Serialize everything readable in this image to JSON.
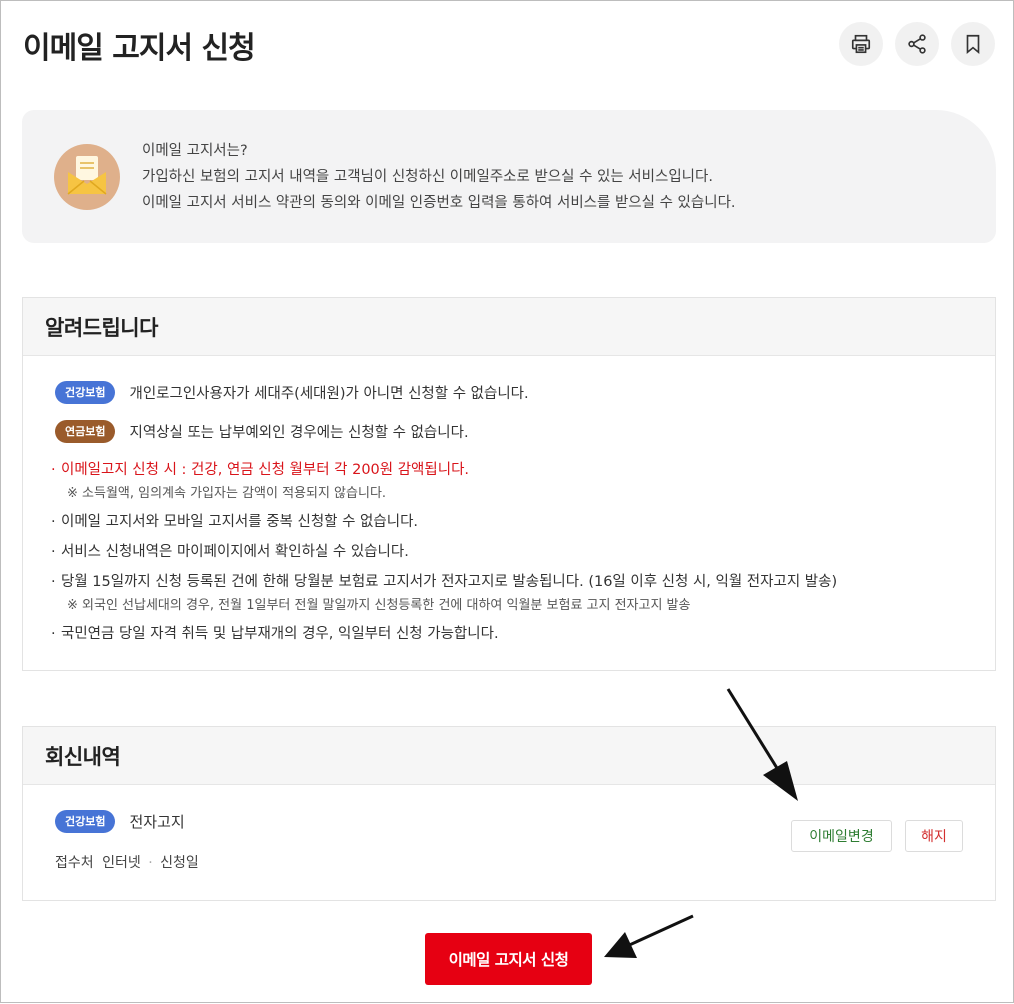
{
  "header": {
    "title": "이메일 고지서 신청",
    "icons": [
      "print-icon",
      "share-icon",
      "bookmark-icon"
    ]
  },
  "intro": {
    "icon": "envelope-icon",
    "lines": [
      "이메일 고지서는?",
      "가입하신 보험의 고지서 내역을 고객님이 신청하신 이메일주소로 받으실 수 있는 서비스입니다.",
      "이메일 고지서 서비스 약관의 동의와 이메일 인증번호 입력을 통하여 서비스를 받으실 수 있습니다."
    ]
  },
  "notice": {
    "title": "알려드립니다",
    "badge_rows": [
      {
        "badge": "건강보험",
        "text": "개인로그인사용자가 세대주(세대원)가 아니면 신청할 수 없습니다."
      },
      {
        "badge": "연금보험",
        "text": "지역상실 또는 납부예외인 경우에는 신청할 수 없습니다."
      }
    ],
    "bullets": [
      {
        "text": "이메일고지 신청 시 : 건강, 연금 신청 월부터 각 200원 감액됩니다.",
        "sub": "※ 소득월액, 임의계속 가입자는 감액이 적용되지 않습니다."
      },
      {
        "text": "이메일 고지서와 모바일 고지서를 중복 신청할 수 없습니다."
      },
      {
        "text": "서비스 신청내역은 마이페이지에서 확인하실 수 있습니다."
      },
      {
        "text": "당월 15일까지 신청 등록된 건에 한해 당월분 보험료 고지서가 전자고지로 발송됩니다. (16일 이후 신청 시, 익월 전자고지 발송)",
        "sub": "※ 외국인 선납세대의 경우, 전월 1일부터 전월 말일까지 신청등록한 건에 대하여 익월분 보험료 고지 전자고지 발송"
      },
      {
        "text": "국민연금 당일 자격 취득 및 납부재개의 경우, 익일부터 신청 가능합니다."
      }
    ]
  },
  "reply": {
    "title": "회신내역",
    "badge": "건강보험",
    "type": "전자고지",
    "meta_label1": "접수처",
    "meta_value1": "인터넷",
    "meta_label2": "신청일",
    "change_email": "이메일변경",
    "cancel": "해지"
  },
  "apply_button": "이메일 고지서 신청",
  "colors": {
    "accent_red": "#e60012",
    "badge_blue": "#4774d6",
    "badge_brown": "#9a5b2b",
    "change_green": "#2e7d32",
    "cancel_red": "#d32f2f"
  }
}
